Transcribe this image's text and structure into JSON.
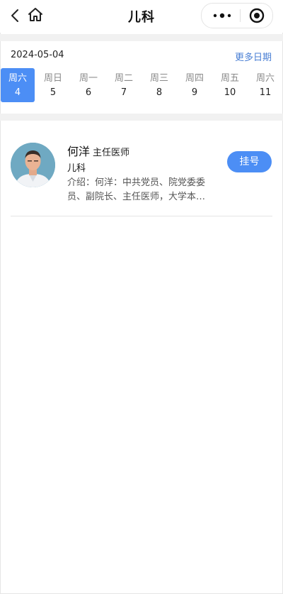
{
  "header": {
    "title": "儿科"
  },
  "date_picker": {
    "current_date": "2024-05-04",
    "more_dates_label": "更多日期",
    "days": [
      {
        "weekday": "周六",
        "date": "4"
      },
      {
        "weekday": "周日",
        "date": "5"
      },
      {
        "weekday": "周一",
        "date": "6"
      },
      {
        "weekday": "周二",
        "date": "7"
      },
      {
        "weekday": "周三",
        "date": "8"
      },
      {
        "weekday": "周四",
        "date": "9"
      },
      {
        "weekday": "周五",
        "date": "10"
      },
      {
        "weekday": "周六",
        "date": "11"
      }
    ],
    "selected_date": "4"
  },
  "doctors": [
    {
      "name": "何洋",
      "title": "主任医师",
      "department": "儿科",
      "intro_line1": "介绍：何洋：中共党员、院党委委",
      "intro_line2": "员、副院长、主任医师，大学本…",
      "button_label": "挂号"
    }
  ],
  "colors": {
    "accent": "#4c8ef5",
    "link": "#4a7fd4",
    "separator": "#f1f1f1"
  }
}
